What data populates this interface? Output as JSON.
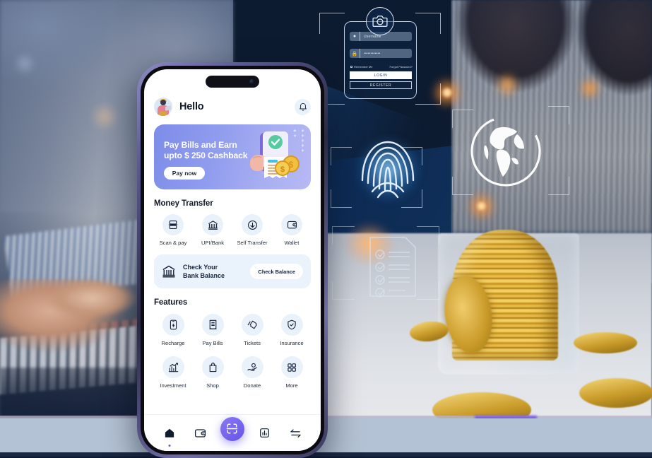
{
  "background": {
    "login_overlay": {
      "camera_icon": "camera-icon",
      "username_placeholder": "Username",
      "password_value": "••••••••••••",
      "remember_label": "Remember Me",
      "forgot_label": "Forgot Password?",
      "login_button": "LOGIN",
      "register_button": "REGISTER"
    },
    "graphics": [
      "fingerprint-scan-icon",
      "globe-icon",
      "checklist-document-icon",
      "corner-bracket-frame"
    ],
    "scene_description_elements": [
      "hands-on-calculator",
      "coin-jar",
      "person-in-sweater",
      "tablet-device"
    ]
  },
  "phone": {
    "status": {
      "dynamic_island": true
    },
    "header": {
      "avatar": "user-avatar-with-laptop",
      "greeting": "Hello",
      "notification_icon": "bell-icon"
    },
    "promo": {
      "line1": "Pay Bills and Earn",
      "line2": "upto $ 250 Cashback",
      "cta": "Pay now",
      "gradient_from": "#7d8ce8",
      "gradient_to": "#b7b9f3"
    },
    "money_transfer": {
      "title": "Money Transfer",
      "items": [
        {
          "label": "Scan & pay",
          "icon": "scan-pay-icon"
        },
        {
          "label": "UPI/Bank",
          "icon": "bank-icon"
        },
        {
          "label": "Self Transfer",
          "icon": "arrow-down-circle-icon"
        },
        {
          "label": "Wallet",
          "icon": "wallet-icon"
        }
      ]
    },
    "balance_card": {
      "icon": "bank-icon",
      "line1": "Check Your",
      "line2": "Bank Balance",
      "button": "Check Balance"
    },
    "features": {
      "title": "Features",
      "items": [
        {
          "label": "Recharge",
          "icon": "mobile-recharge-icon"
        },
        {
          "label": "Pay Bills",
          "icon": "receipt-icon"
        },
        {
          "label": "Tickets",
          "icon": "ticket-icon"
        },
        {
          "label": "Insurance",
          "icon": "shield-check-icon"
        },
        {
          "label": "Investment",
          "icon": "growth-chart-icon"
        },
        {
          "label": "Shop",
          "icon": "shopping-bag-icon"
        },
        {
          "label": "Donate",
          "icon": "donate-hand-icon"
        },
        {
          "label": "More",
          "icon": "grid-more-icon"
        }
      ]
    },
    "bottom_nav": {
      "items": [
        {
          "icon": "home-icon",
          "active": true
        },
        {
          "icon": "wallet-icon",
          "active": false
        },
        {
          "icon": "scan-qr-icon",
          "active": false,
          "fab": true
        },
        {
          "icon": "bar-chart-icon",
          "active": false
        },
        {
          "icon": "transfer-arrows-icon",
          "active": false
        }
      ],
      "accent_color": "#6553e8"
    }
  }
}
